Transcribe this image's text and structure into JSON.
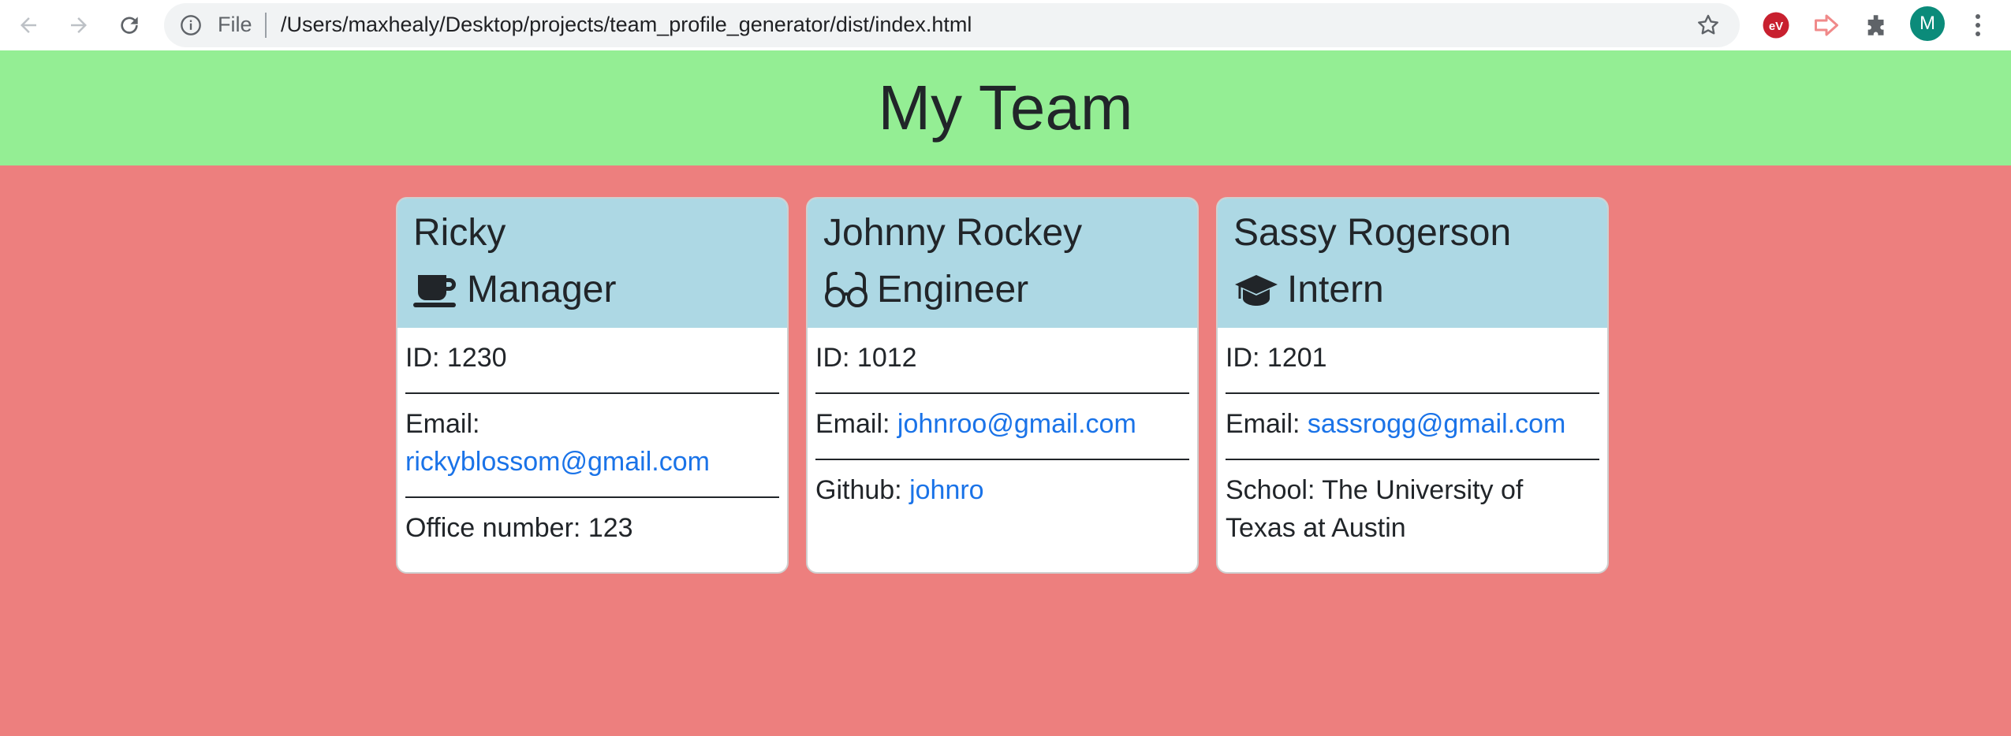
{
  "browser": {
    "file_label": "File",
    "url": "/Users/maxhealy/Desktop/projects/team_profile_generator/dist/index.html",
    "avatar_initial": "M"
  },
  "page": {
    "title": "My Team"
  },
  "cards": [
    {
      "name": "Ricky",
      "role": "Manager",
      "role_icon": "coffee-mug-icon",
      "id_label": "ID:",
      "id_value": "1230",
      "email_label": "Email:",
      "email": "rickyblossom@gmail.com",
      "extra_label": "Office number:",
      "extra_value": "123"
    },
    {
      "name": "Johnny Rockey",
      "role": "Engineer",
      "role_icon": "glasses-icon",
      "id_label": "ID:",
      "id_value": "1012",
      "email_label": "Email:",
      "email": "johnroo@gmail.com",
      "extra_label": "Github:",
      "extra_value": "johnro"
    },
    {
      "name": "Sassy Rogerson",
      "role": "Intern",
      "role_icon": "graduation-cap-icon",
      "id_label": "ID:",
      "id_value": "1201",
      "email_label": "Email:",
      "email": "sassrogg@gmail.com",
      "extra_label": "School:",
      "extra_value": "The University of Texas at Austin"
    }
  ],
  "colors": {
    "header_bg": "#94ee94",
    "page_bg": "#ed7f7e",
    "card_header_bg": "#add8e4",
    "link": "#1a73e8"
  }
}
